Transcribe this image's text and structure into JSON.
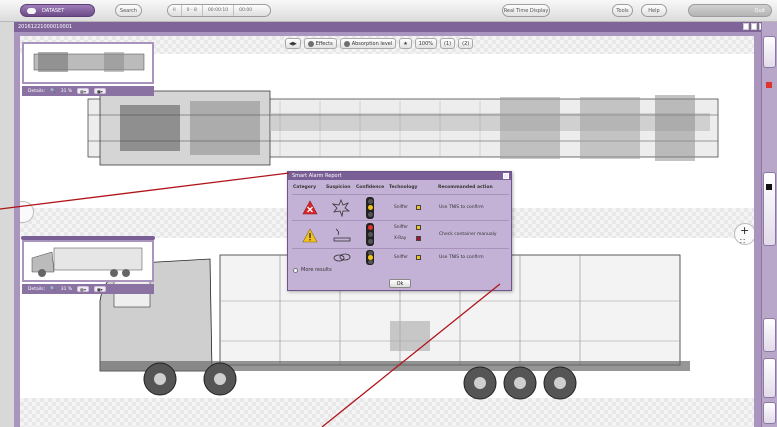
{
  "topbar": {
    "dataset_label": "DATASET",
    "search_label": "Search",
    "transport": [
      "II",
      "0 - 8",
      "00:00:10",
      "00:00"
    ],
    "realtime_label": "Real Time Display",
    "tools_label": "Tools",
    "help_label": "Help",
    "right_label": "",
    "quit_label": "Quit"
  },
  "image": {
    "id": "20161221000010001"
  },
  "view_toolbar": {
    "effects_label": "Effects",
    "absorption_label": "Absorption level",
    "zoom_label": "100%",
    "v1": "(1)",
    "v2": "(2)"
  },
  "thumbnails": [
    {
      "details_label": "Details:",
      "zoom": "31 %"
    },
    {
      "details_label": "Details:",
      "zoom": "31 %"
    }
  ],
  "alarm": {
    "title": "Smart Alarm Report",
    "headers": {
      "category": "Category",
      "suspicion": "Suspicion",
      "confidence": "Confidence",
      "technology": "Technology",
      "action": "Recommanded action"
    },
    "rows": [
      {
        "technologies": [
          "Sniffer"
        ],
        "action": "Use TNIS to confirm",
        "category_color": "#d8262a"
      },
      {
        "technologies": [
          "Sniffer",
          "X-Ray"
        ],
        "action": "Check container manualy",
        "category_color": "#f2c21c"
      },
      {
        "technologies": [
          "Sniffer"
        ],
        "action": "Use TNIS to confirm",
        "category_color": ""
      }
    ],
    "more_results_label": "More results",
    "ok_label": "Ok"
  },
  "colors": {
    "accent": "#7a5e96",
    "frame": "#a995bd",
    "alarm_red": "#d8262a",
    "alarm_yellow": "#f2c21c"
  }
}
